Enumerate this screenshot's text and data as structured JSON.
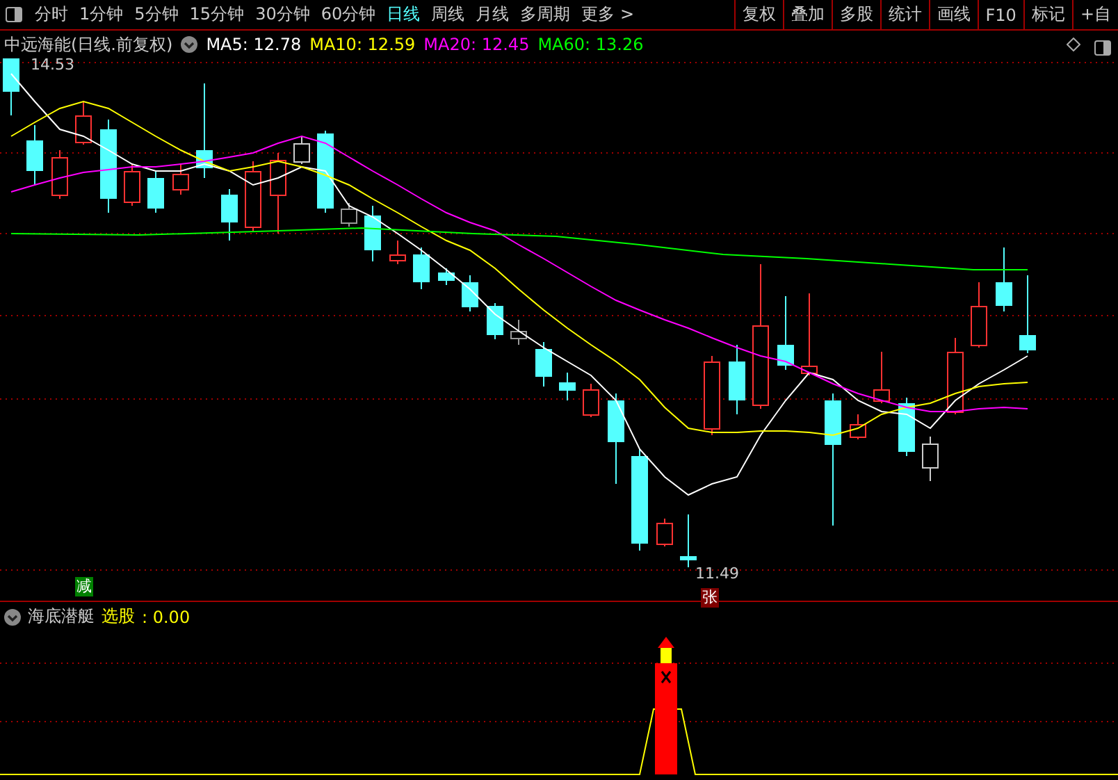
{
  "toolbar": {
    "periods": [
      {
        "label": "分时",
        "selected": false
      },
      {
        "label": "1分钟",
        "selected": false
      },
      {
        "label": "5分钟",
        "selected": false
      },
      {
        "label": "15分钟",
        "selected": false
      },
      {
        "label": "30分钟",
        "selected": false
      },
      {
        "label": "60分钟",
        "selected": false
      },
      {
        "label": "日线",
        "selected": true
      },
      {
        "label": "周线",
        "selected": false
      },
      {
        "label": "月线",
        "selected": false
      },
      {
        "label": "多周期",
        "selected": false
      },
      {
        "label": "更多 >",
        "selected": false
      }
    ],
    "tools": [
      "复权",
      "叠加",
      "多股",
      "统计",
      "画线",
      "F10",
      "标记",
      "+自"
    ]
  },
  "main_chart": {
    "title": "中远海能(日线.前复权)",
    "indicators": [
      {
        "label": "MA5: 12.78",
        "color": "#ffffff"
      },
      {
        "label": "MA10: 12.59",
        "color": "#ffff00"
      },
      {
        "label": "MA20: 12.45",
        "color": "#ff00ff"
      },
      {
        "label": "MA60: 13.26",
        "color": "#00ff00"
      }
    ],
    "high_label": "14.53",
    "low_label": "11.49",
    "markers": [
      {
        "text": "减",
        "color": "#008000"
      },
      {
        "text": "张",
        "color": "#800000"
      }
    ]
  },
  "sub_chart": {
    "name": "海底潜艇",
    "signal_label": "选股",
    "signal_value": ": 0.00"
  }
}
